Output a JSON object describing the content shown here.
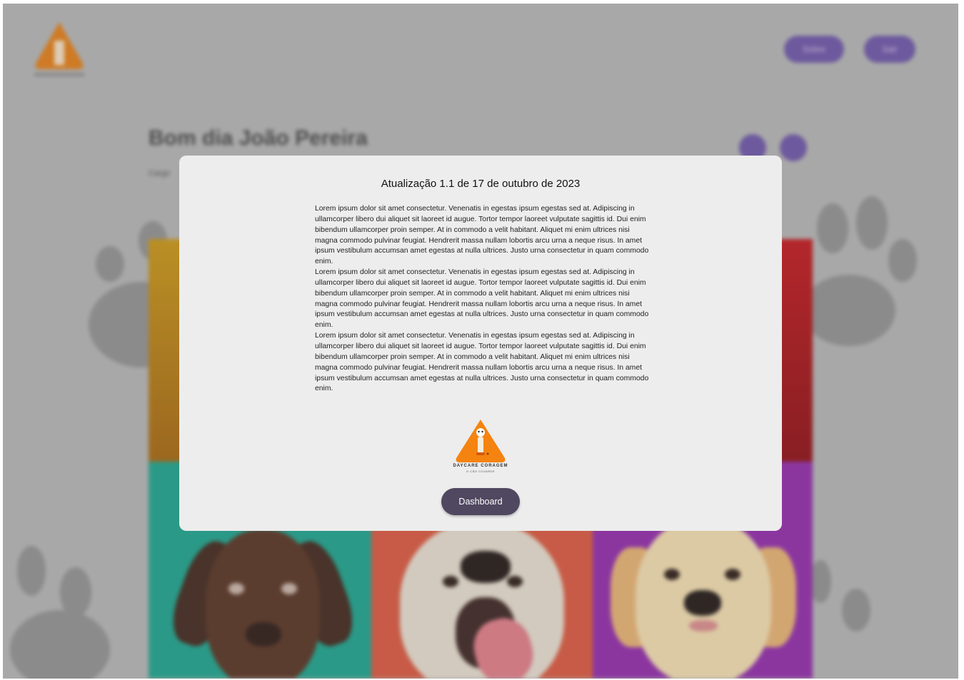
{
  "background": {
    "header": {
      "nav_buttons": [
        "Sobre",
        "Sair"
      ]
    },
    "greeting": "Bom dia João Pereira",
    "role": "Cargo"
  },
  "modal": {
    "title": "Atualização 1.1 de 17 de outubro de 2023",
    "paragraphs": [
      "Lorem ipsum dolor sit amet consectetur. Venenatis in egestas ipsum egestas sed at. Adipiscing in ullamcorper libero dui aliquet sit laoreet id augue. Tortor tempor laoreet vulputate sagittis id. Dui enim bibendum ullamcorper proin semper. At in commodo a velit habitant. Aliquet mi enim ultrices nisi magna commodo pulvinar feugiat. Hendrerit massa nullam lobortis arcu urna a neque risus. In amet ipsum vestibulum accumsan amet egestas at nulla ultrices. Justo urna consectetur in quam commodo enim.",
      "Lorem ipsum dolor sit amet consectetur. Venenatis in egestas ipsum egestas sed at. Adipiscing in ullamcorper libero dui aliquet sit laoreet id augue. Tortor tempor laoreet vulputate sagittis id. Dui enim bibendum ullamcorper proin semper. At in commodo a velit habitant. Aliquet mi enim ultrices nisi magna commodo pulvinar feugiat. Hendrerit massa nullam lobortis arcu urna a neque risus. In amet ipsum vestibulum accumsan amet egestas at nulla ultrices. Justo urna consectetur in quam commodo enim.",
      "Lorem ipsum dolor sit amet consectetur. Venenatis in egestas ipsum egestas sed at. Adipiscing in ullamcorper libero dui aliquet sit laoreet id augue. Tortor tempor laoreet vulputate sagittis id. Dui enim bibendum ullamcorper proin semper. At in commodo a velit habitant. Aliquet mi enim ultrices nisi magna commodo pulvinar feugiat. Hendrerit massa nullam lobortis arcu urna a neque risus. In amet ipsum vestibulum accumsan amet egestas at nulla ultrices. Justo urna consectetur in quam commodo enim."
    ],
    "logo": {
      "name": "DAYCARE CORAGEM",
      "tagline": "O CÃO COVARDE"
    },
    "dashboard_button": "Dashboard"
  },
  "colors": {
    "accent_orange": "#f5830f",
    "button_purple": "#6b52a6",
    "dashboard_button": "#4f4860",
    "modal_bg": "#ededed",
    "backdrop": "#b3b3b3"
  },
  "icons": {
    "logo": "dog-triangle-logo",
    "circle_buttons": [
      "settings-icon",
      "share-icon"
    ]
  }
}
